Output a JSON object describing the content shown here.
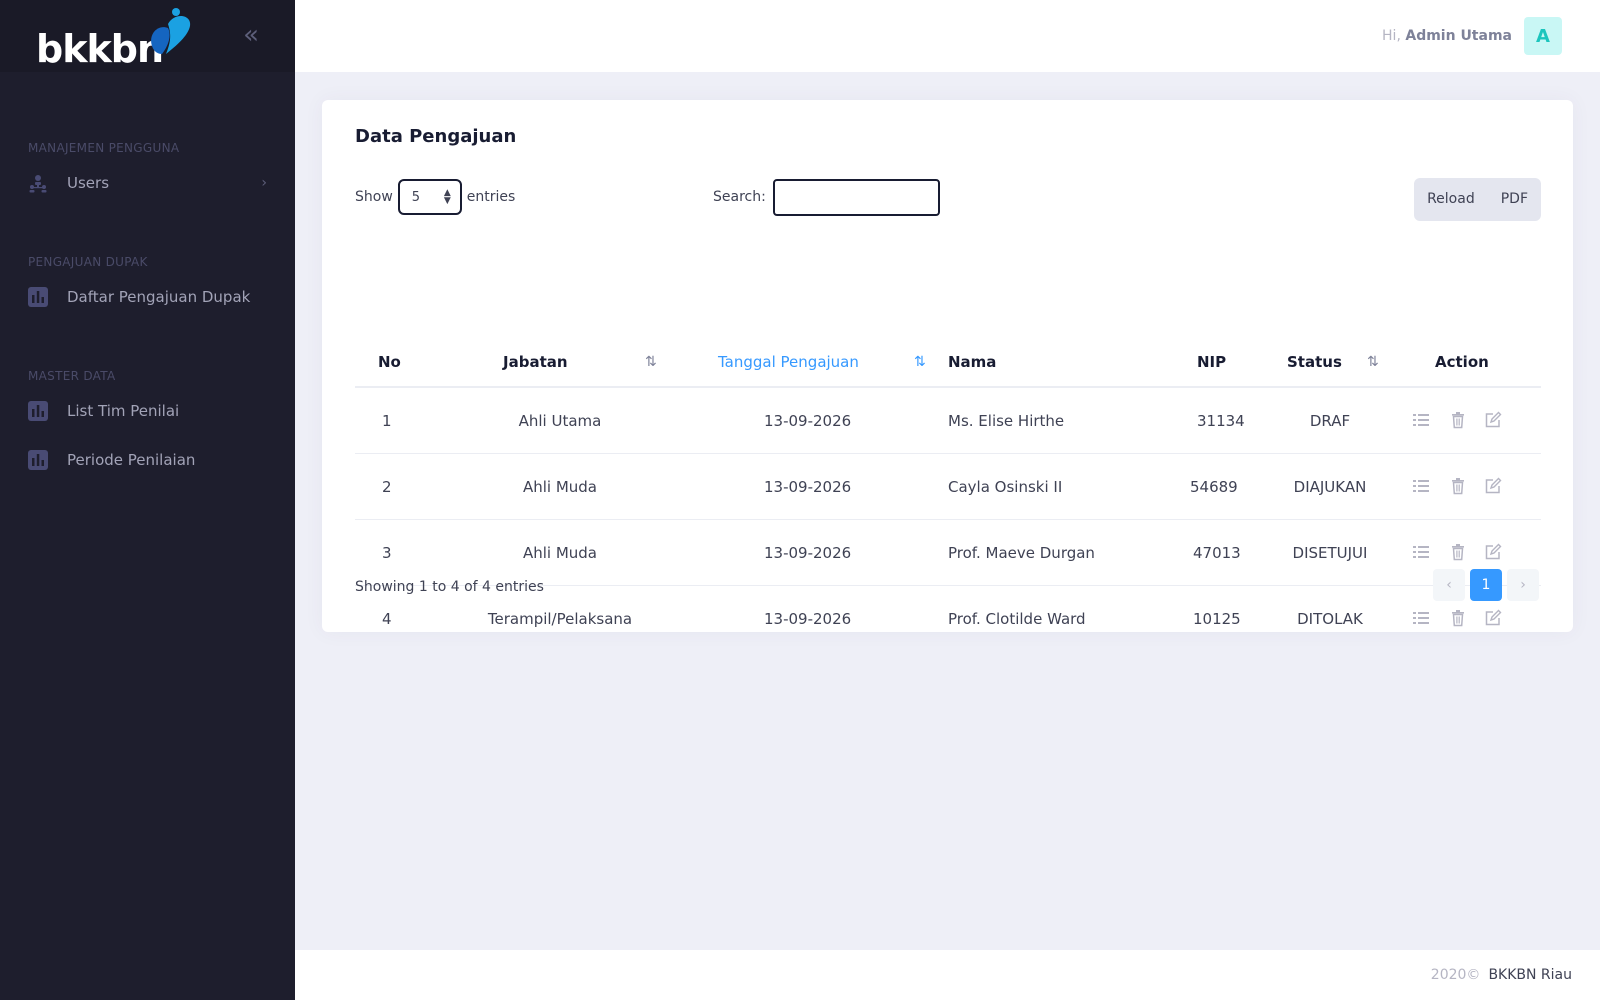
{
  "brand": {
    "logo_text": "bkkbn",
    "accent": "#0a84d6"
  },
  "header": {
    "greeting": "Hi,",
    "user_name": "Admin Utama",
    "avatar_initial": "A"
  },
  "sidebar": {
    "sections": [
      {
        "title": "MANAJEMEN PENGGUNA",
        "items": [
          {
            "label": "Users",
            "icon": "users-icon",
            "has_submenu": true
          }
        ]
      },
      {
        "title": "PENGAJUAN DUPAK",
        "items": [
          {
            "label": "Daftar Pengajuan Dupak",
            "icon": "bar-chart-icon"
          }
        ]
      },
      {
        "title": "MASTER DATA",
        "items": [
          {
            "label": "List Tim Penilai",
            "icon": "bar-chart-icon"
          },
          {
            "label": "Periode Penilaian",
            "icon": "bar-chart-icon"
          }
        ]
      }
    ]
  },
  "card": {
    "title": "Data Pengajuan",
    "show_label": "Show",
    "entries_label": "entries",
    "page_length": "5",
    "search_label": "Search:",
    "search_value": "",
    "buttons": {
      "reload": "Reload",
      "pdf": "PDF"
    }
  },
  "table": {
    "columns": [
      "No",
      "Jabatan",
      "Tanggal Pengajuan",
      "Nama",
      "NIP",
      "Status",
      "Action"
    ],
    "sorted_column": "Tanggal Pengajuan",
    "rows": [
      {
        "no": "1",
        "jabatan": "Ahli Utama",
        "tanggal": "13-09-2026",
        "nama": "Ms. Elise Hirthe",
        "nip": "31134",
        "status": "DRAF"
      },
      {
        "no": "2",
        "jabatan": "Ahli Muda",
        "tanggal": "13-09-2026",
        "nama": "Cayla Osinski II",
        "nip": "54689",
        "status": "DIAJUKAN"
      },
      {
        "no": "3",
        "jabatan": "Ahli Muda",
        "tanggal": "13-09-2026",
        "nama": "Prof. Maeve Durgan",
        "nip": "47013",
        "status": "DISETUJUI"
      },
      {
        "no": "4",
        "jabatan": "Terampil/Pelaksana",
        "tanggal": "13-09-2026",
        "nama": "Prof. Clotilde Ward",
        "nip": "10125",
        "status": "DITOLAK"
      }
    ],
    "info": "Showing 1 to 4 of 4 entries",
    "pagination": {
      "prev": "‹",
      "current": "1",
      "next": "›"
    }
  },
  "footer": {
    "year": "2020©",
    "org": "BKKBN Riau"
  },
  "colors": {
    "sidebar_bg": "#1e1e2d",
    "primary": "#3699ff",
    "avatar_bg": "#c9f7f5",
    "avatar_fg": "#1bc5bd"
  }
}
